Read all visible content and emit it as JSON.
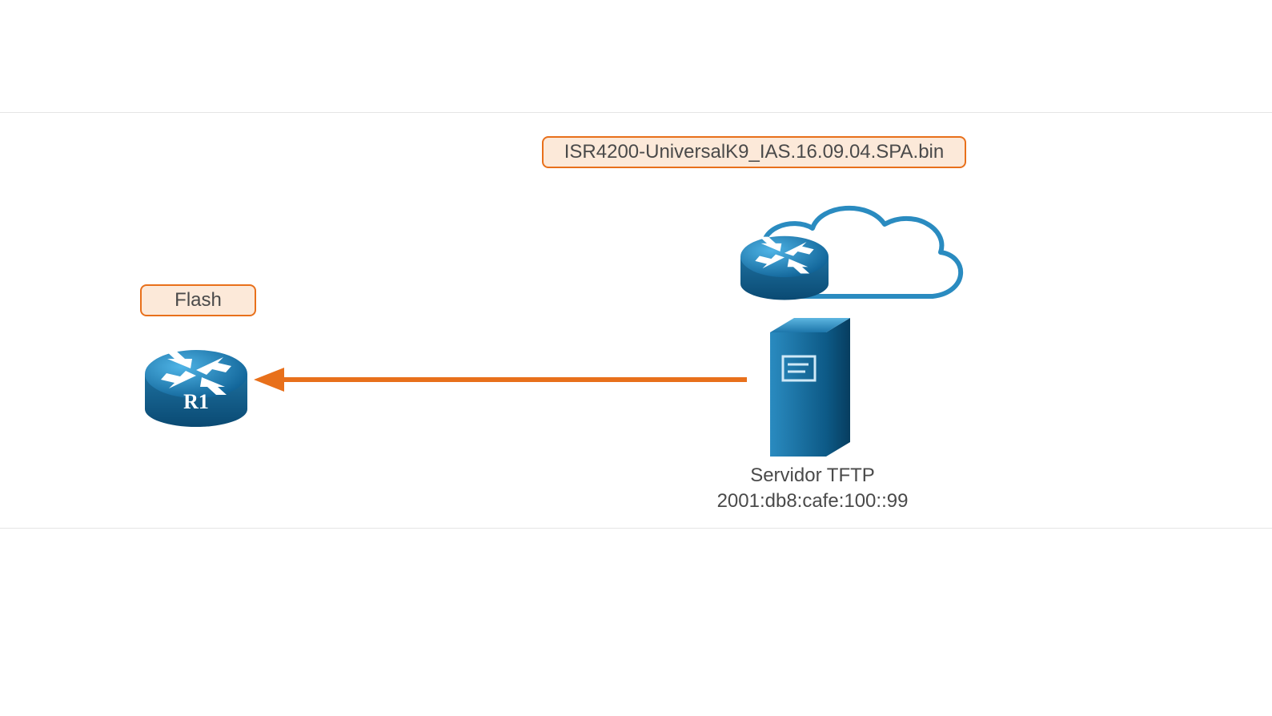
{
  "labels": {
    "flash": "Flash",
    "file": "ISR4200-UniversalK9_IAS.16.09.04.SPA.bin"
  },
  "devices": {
    "router_r1": {
      "name": "R1"
    },
    "server": {
      "title": "Servidor TFTP",
      "address": "2001:db8:cafe:100::99"
    }
  },
  "colors": {
    "accent_orange": "#e8701b",
    "pill_fill": "#fce9d9",
    "device_blue_light": "#2a8bc0",
    "device_blue_dark": "#0d5a87",
    "cloud_stroke": "#2a8bc0"
  }
}
